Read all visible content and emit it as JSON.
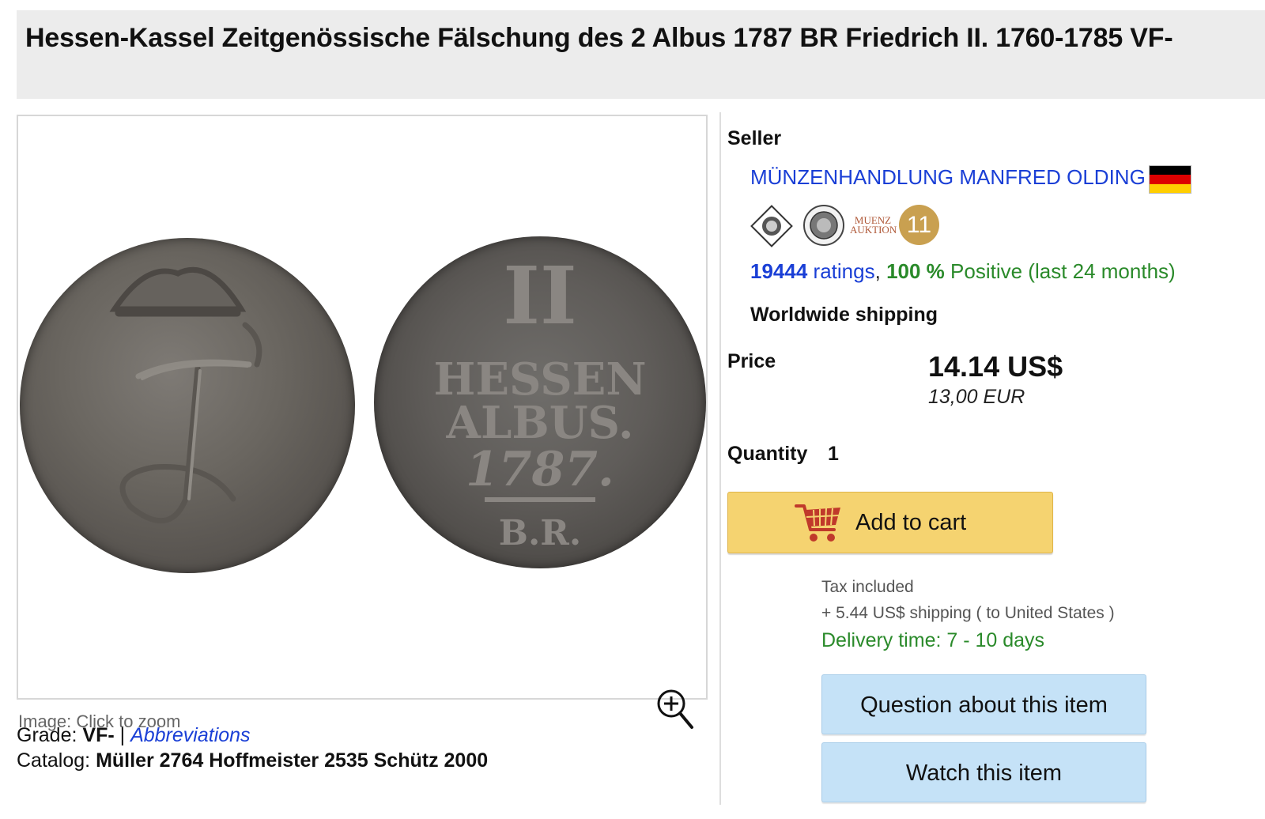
{
  "listing": {
    "title": "Hessen-Kassel Zeitgenössische Fälschung des 2 Albus 1787 BR Friedrich II. 1760-1785 VF-"
  },
  "image_panel": {
    "caption": "Image: Click to zoom",
    "zoom_icon": "zoom-in-icon",
    "coins": [
      "coin-obverse",
      "coin-reverse"
    ]
  },
  "details": {
    "grade_label": "Grade:",
    "grade_value": "VF-",
    "separator": "|",
    "abbreviations_link": "Abbreviations",
    "catalog_label": "Catalog:",
    "catalog_value": "Müller 2764 Hoffmeister 2535 Schütz 2000"
  },
  "seller": {
    "label": "Seller",
    "name": "MÜNZENHANDLUNG MANFRED OLDING",
    "flag_colors": [
      "#000000",
      "#dd0000",
      "#ffce00"
    ],
    "badges": [
      "association-seal-1",
      "association-seal-2",
      "muenz-auktion-logo"
    ],
    "badge_text": [
      "MUENZ",
      "AUKTION"
    ],
    "rating_badge": "11",
    "ratings_count": "19444",
    "ratings_word": "ratings",
    "comma": ",",
    "positive_pct": "100 %",
    "positive_text": "Positive (last 24 months)",
    "shipping_scope": "Worldwide shipping"
  },
  "purchase": {
    "price_label": "Price",
    "price_usd": "14.14 US$",
    "price_eur": "13,00 EUR",
    "quantity_label": "Quantity",
    "quantity_value": "1",
    "add_to_cart": "Add to cart",
    "tax_note": "Tax included",
    "shipping_note": "+ 5.44 US$ shipping ( to United States )",
    "delivery_time": "Delivery time: 7 - 10 days",
    "question_button": "Question about this item",
    "watch_button": "Watch this item"
  },
  "colors": {
    "link_blue": "#1a3fd6",
    "positive_green": "#2a8a2a",
    "cart_button": "#f5d370",
    "secondary_button": "#c5e2f7",
    "title_background": "#ececec",
    "rating_badge": "#c9a050"
  }
}
